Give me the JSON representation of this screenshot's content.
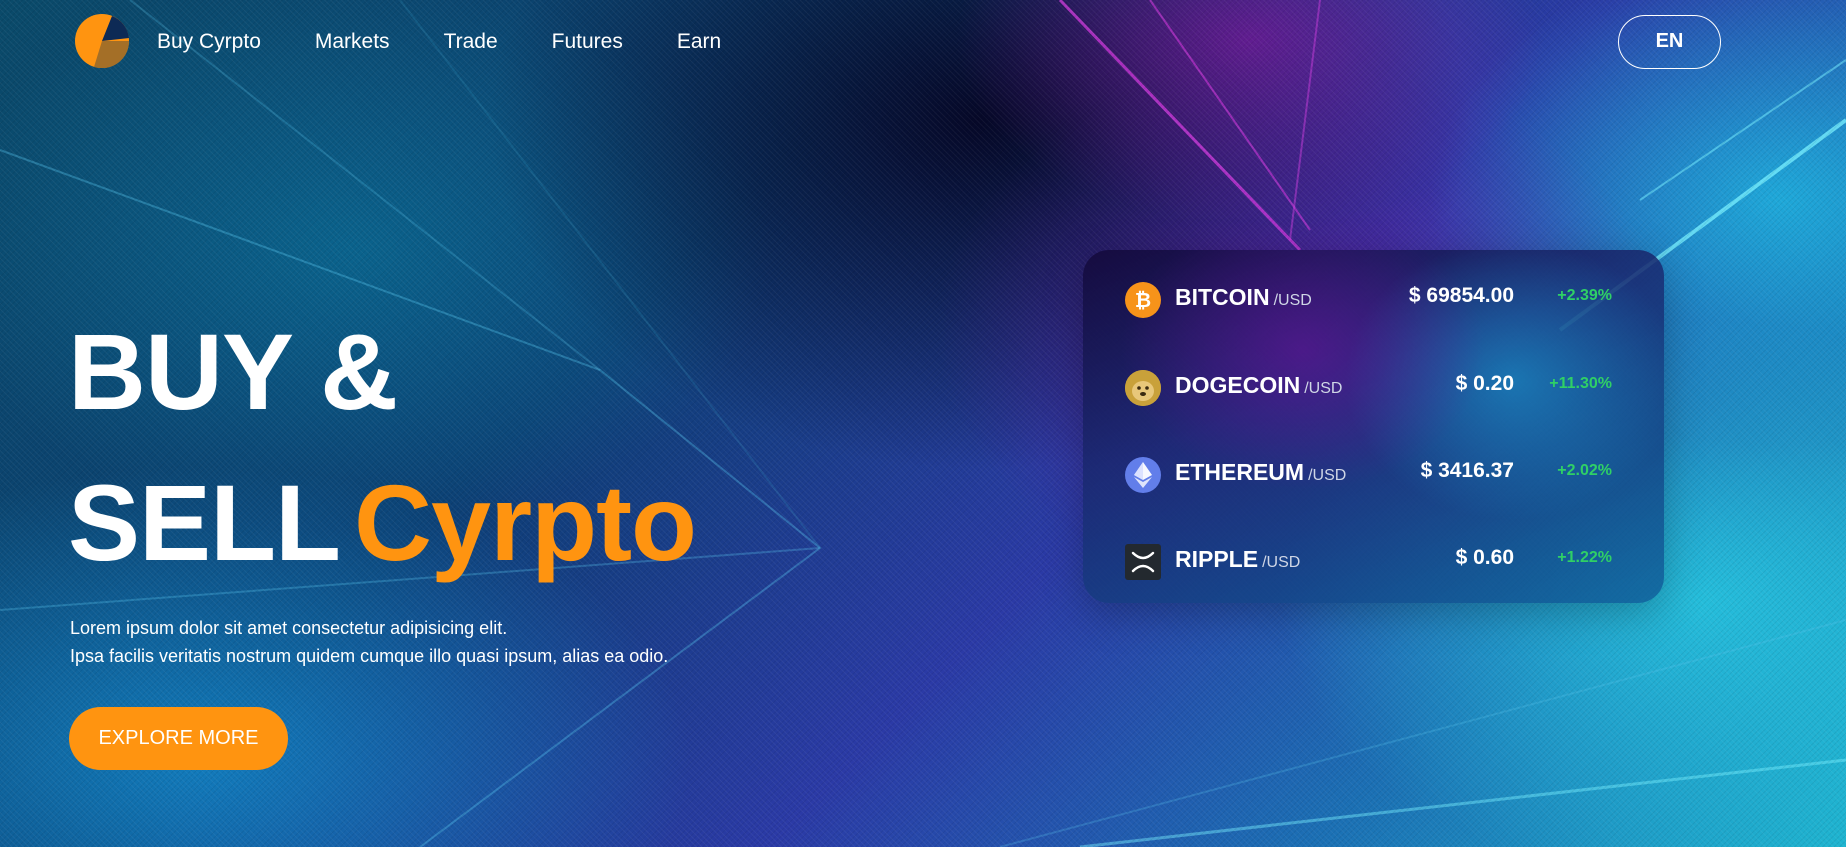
{
  "brand": {
    "accent_color": "#ff9410",
    "change_color": "#2fd066"
  },
  "nav": {
    "logo_icon": "brand-logo",
    "links": [
      "Buy Cyrpto",
      "Markets",
      "Trade",
      "Futures",
      "Earn"
    ],
    "language": "EN"
  },
  "hero": {
    "line1": "BUY &",
    "line2_plain": "SELL",
    "line2_accent": "Cyrpto",
    "description_1": "Lorem ipsum dolor sit amet consectetur adipisicing elit.",
    "description_2": "Ipsa facilis veritatis nostrum quidem cumque illo quasi ipsum, alias ea odio.",
    "cta_label": "EXPLORE MORE"
  },
  "prices": [
    {
      "name": "BITCOIN",
      "unit": "/USD",
      "price": "$ 69854.00",
      "change": "+2.39%",
      "icon": "bitcoin-icon"
    },
    {
      "name": "DOGECOIN",
      "unit": "/USD",
      "price": "$ 0.20",
      "change": "+11.30%",
      "icon": "dogecoin-icon"
    },
    {
      "name": "ETHEREUM",
      "unit": "/USD",
      "price": "$ 3416.37",
      "change": "+2.02%",
      "icon": "ethereum-icon"
    },
    {
      "name": "RIPPLE",
      "unit": "/USD",
      "price": "$ 0.60",
      "change": "+1.22%",
      "icon": "ripple-icon"
    }
  ]
}
